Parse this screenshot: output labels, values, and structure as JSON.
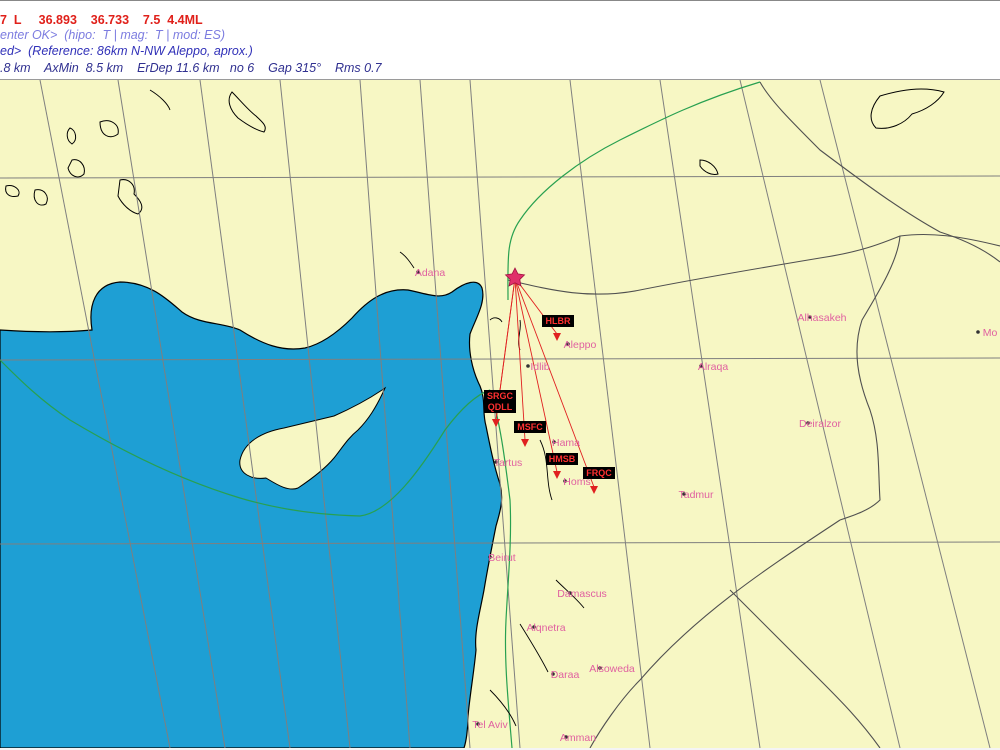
{
  "header": {
    "line1": "7  L     36.893    36.733    7.5  4.4ML",
    "line2": "enter OK>  (hipo:  T | mag:  T | mod: ES)",
    "line3": "ed>  (Reference: 86km N-NW Aleppo, aprox.)",
    "line4": ".8 km    AxMin  8.5 km    ErDep 11.6 km   no 6    Gap 315°    Rms 0.7"
  },
  "map": {
    "colors": {
      "sea": "#1e9fd4",
      "land": "#f7f7c4",
      "grid": "#7f7f7f",
      "border": "#28a050",
      "admin": "#505050",
      "city": "#e060a0",
      "ray": "#e02020",
      "station_box": "#000000",
      "station_text": "#ff3030",
      "epicenter": "#e0306a"
    },
    "epicenter_icon": "star-icon",
    "cities": [
      {
        "name": "Adana"
      },
      {
        "name": "Aleppo"
      },
      {
        "name": "Idlib"
      },
      {
        "name": "Alraqa"
      },
      {
        "name": "Alhasakeh"
      },
      {
        "name": "Mo"
      },
      {
        "name": "Deiralzor"
      },
      {
        "name": "Hama"
      },
      {
        "name": "Tartus"
      },
      {
        "name": "Homs"
      },
      {
        "name": "Tadmur"
      },
      {
        "name": "Beirut"
      },
      {
        "name": "Damascus"
      },
      {
        "name": "Alqnetra"
      },
      {
        "name": "Alsoweda"
      },
      {
        "name": "Daraa"
      },
      {
        "name": "Tel Aviv"
      },
      {
        "name": "Amman"
      }
    ],
    "stations": [
      {
        "code": "HLBR"
      },
      {
        "code": "SRGC"
      },
      {
        "code": "QDLL"
      },
      {
        "code": "MSFC"
      },
      {
        "code": "HMSB"
      },
      {
        "code": "FRQC"
      }
    ]
  }
}
